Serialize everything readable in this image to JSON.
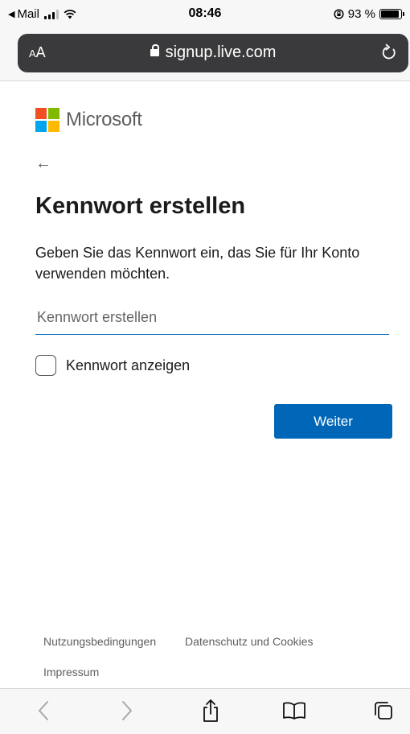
{
  "status_bar": {
    "back_app": "Mail",
    "time": "08:46",
    "battery_percent": "93 %",
    "battery_level": 0.93
  },
  "browser": {
    "text_size_label": "AA",
    "url": "signup.live.com"
  },
  "page": {
    "brand_name": "Microsoft",
    "back_arrow": "←",
    "title": "Kennwort erstellen",
    "description": "Geben Sie das Kennwort ein, das Sie für Ihr Konto verwenden möchten.",
    "password_placeholder": "Kennwort erstellen",
    "password_value": "",
    "show_password_label": "Kennwort anzeigen",
    "show_password_checked": false,
    "next_button": "Weiter"
  },
  "footer": {
    "terms": "Nutzungsbedingungen",
    "privacy": "Datenschutz und Cookies",
    "imprint": "Impressum"
  },
  "toolbar": {
    "items": [
      "back-icon",
      "forward-icon",
      "share-icon",
      "bookmarks-icon",
      "tabs-icon"
    ]
  },
  "colors": {
    "accent": "#0067b8",
    "ms_red": "#f25022",
    "ms_green": "#7fba00",
    "ms_blue": "#00a4ef",
    "ms_yellow": "#ffb900"
  }
}
